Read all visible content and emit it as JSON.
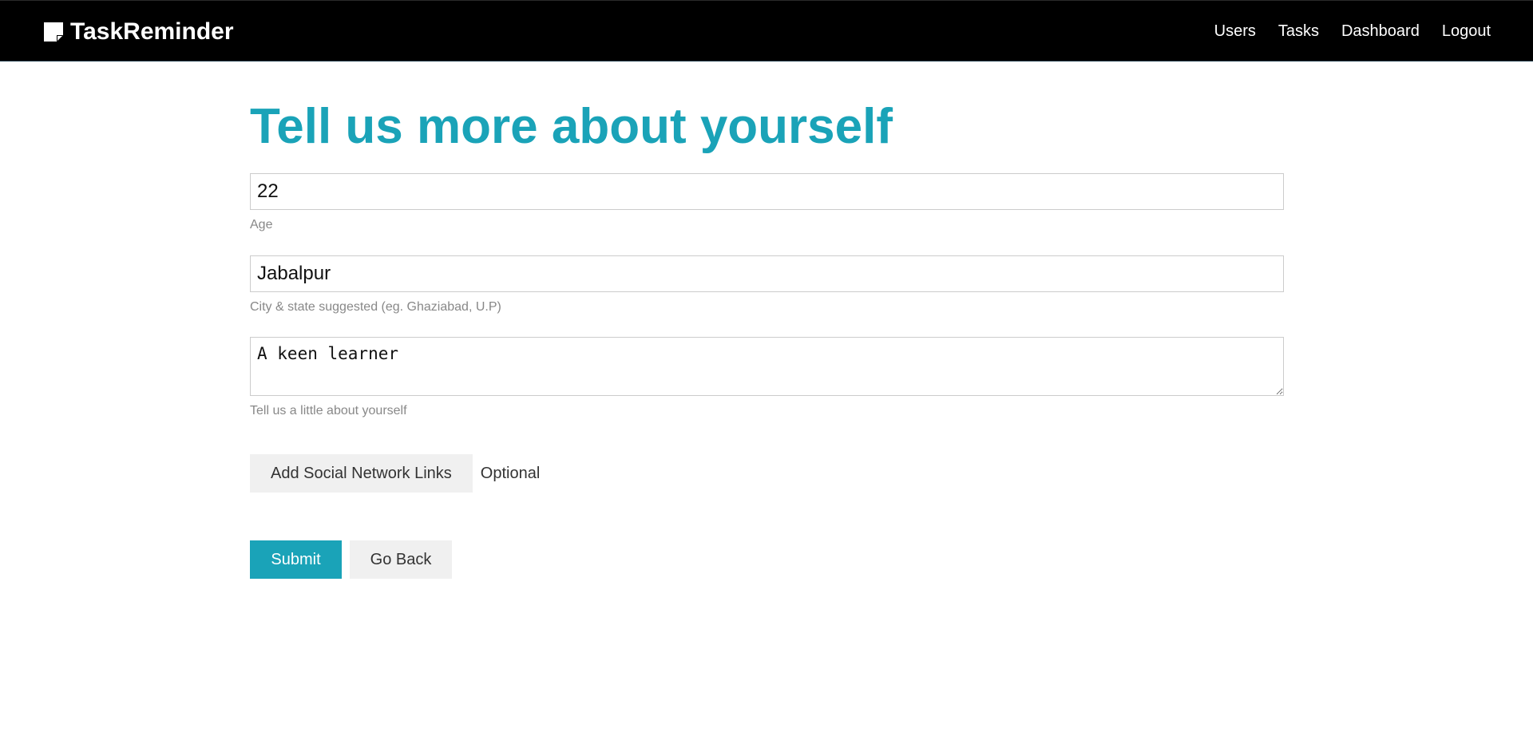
{
  "brand": {
    "name": "TaskReminder",
    "icon": "sticky-note-icon"
  },
  "nav": {
    "links": [
      "Users",
      "Tasks",
      "Dashboard",
      "Logout"
    ]
  },
  "form": {
    "title": "Tell us more about yourself",
    "age": {
      "value": "22",
      "help": "Age"
    },
    "location": {
      "value": "Jabalpur",
      "help": "City & state suggested (eg. Ghaziabad, U.P)"
    },
    "bio": {
      "value": "A keen learner",
      "help": "Tell us a little about yourself"
    },
    "social_button": "Add Social Network Links",
    "social_optional": "Optional",
    "submit_label": "Submit",
    "back_label": "Go Back"
  },
  "colors": {
    "accent": "#1aa3b8",
    "navbar": "#000000",
    "button_light": "#f0f0f0"
  }
}
